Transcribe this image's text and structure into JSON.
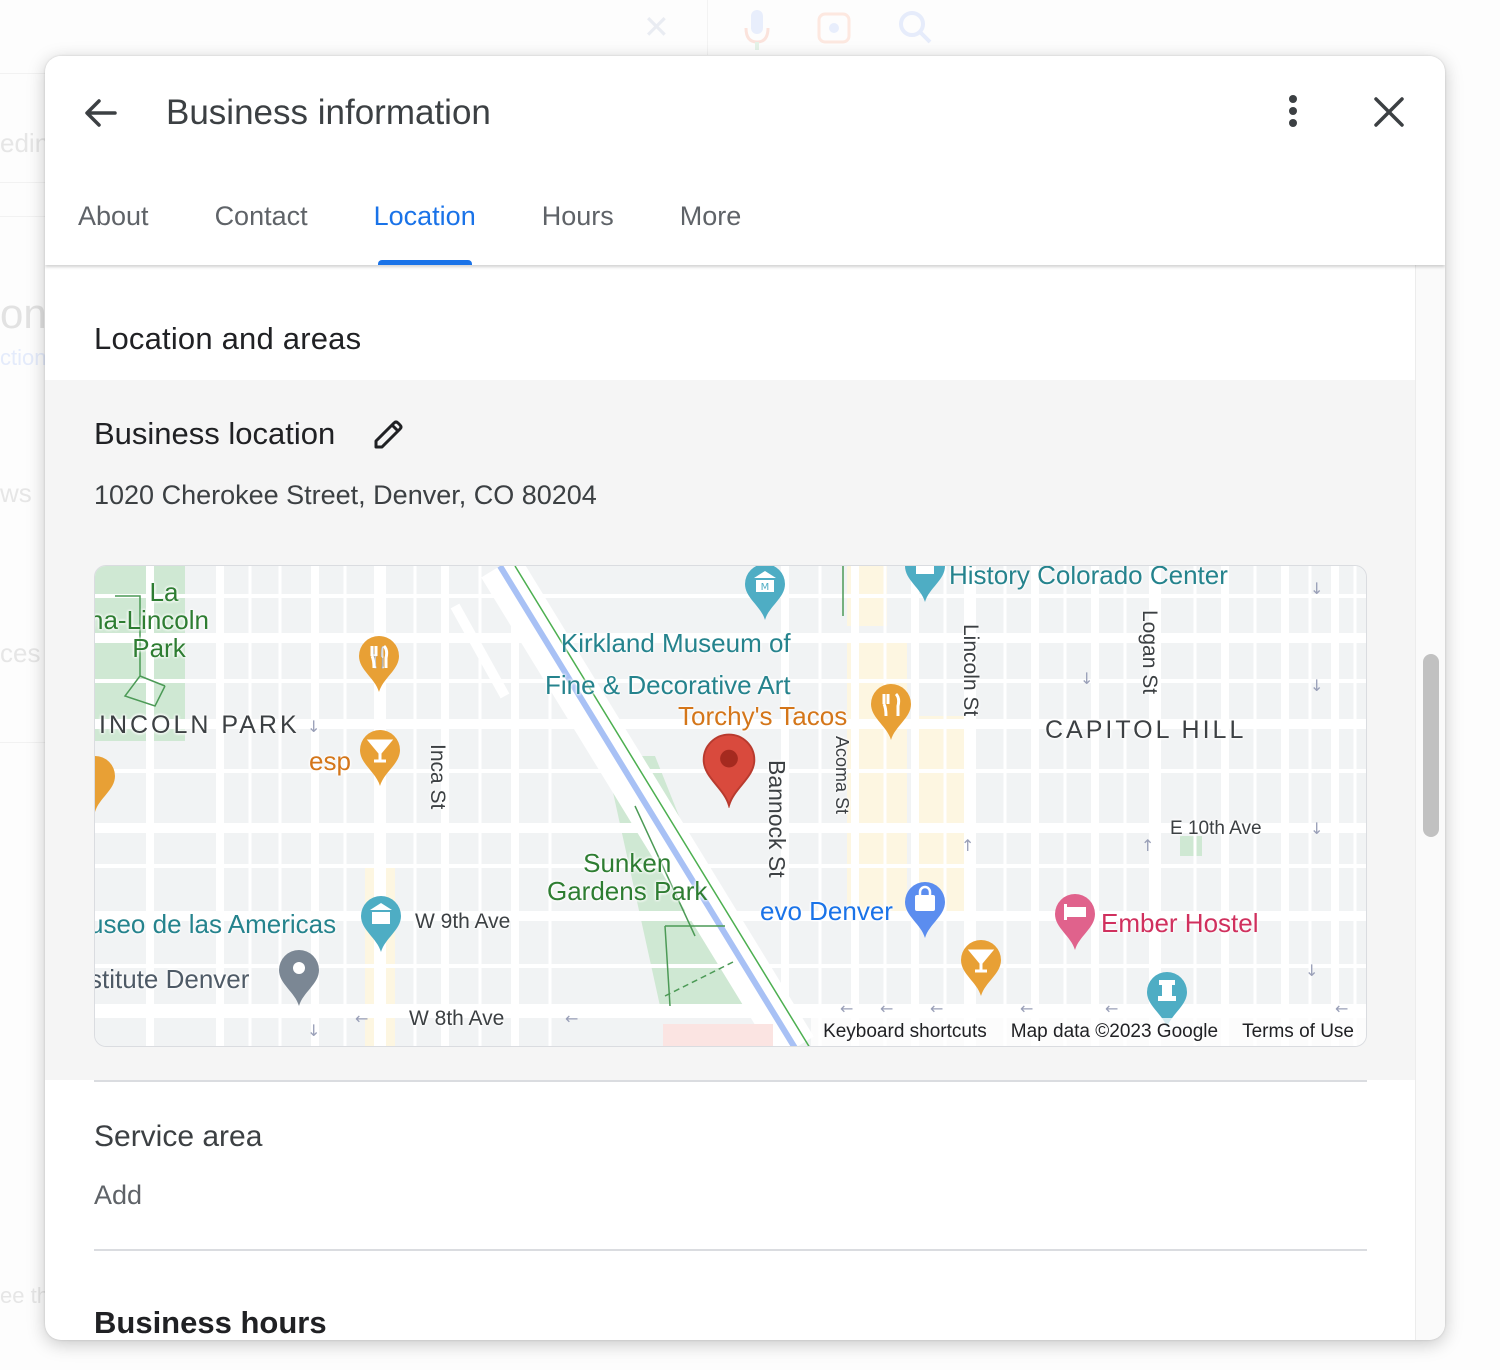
{
  "background": {
    "top_icons": [
      "clear-icon",
      "microphone-icon",
      "lens-icon",
      "search-icon"
    ],
    "fragments": [
      "edin",
      "on",
      "ction",
      "ws",
      "ces",
      "ee th"
    ]
  },
  "dialog": {
    "title": "Business information",
    "tabs": [
      {
        "label": "About",
        "active": false
      },
      {
        "label": "Contact",
        "active": false
      },
      {
        "label": "Location",
        "active": true
      },
      {
        "label": "Hours",
        "active": false
      },
      {
        "label": "More",
        "active": false
      }
    ],
    "accent_color": "#1a73e8"
  },
  "location": {
    "section_title": "Location and areas",
    "business_location_label": "Business location",
    "address": "1020 Cherokee Street, Denver, CO 80204",
    "map": {
      "places": {
        "park_1": [
          "La",
          "na-Lincoln",
          "Park"
        ],
        "district_1": "INCOLN PARK",
        "district_2": "CAPITOL HILL",
        "museum_1": [
          "Kirkland Museum of",
          "Fine & Decorative Art"
        ],
        "museum_2": "History Colorado Center",
        "museum_3": "useo de las Americas",
        "restaurant_1": "Torchy's Tacos",
        "bar_1": "esp",
        "park_2": [
          "Sunken",
          "Gardens Park"
        ],
        "store_1": "evo Denver",
        "hotel_1": "Ember Hostel",
        "institute_1": "stitute Denver"
      },
      "streets": {
        "inca": "Inca St",
        "bannock": "Bannock St",
        "acoma": "Acoma St",
        "lincoln": "Lincoln St",
        "logan": "Logan St",
        "e10th": "E 10th Ave",
        "w9th": "W 9th Ave",
        "w8th": "W 8th Ave"
      },
      "footer": {
        "keyboard": "Keyboard shortcuts",
        "data": "Map data ©2023 Google",
        "terms": "Terms of Use"
      }
    }
  },
  "service_area": {
    "label": "Service area",
    "action": "Add"
  },
  "next_section": {
    "title": "Business hours"
  }
}
